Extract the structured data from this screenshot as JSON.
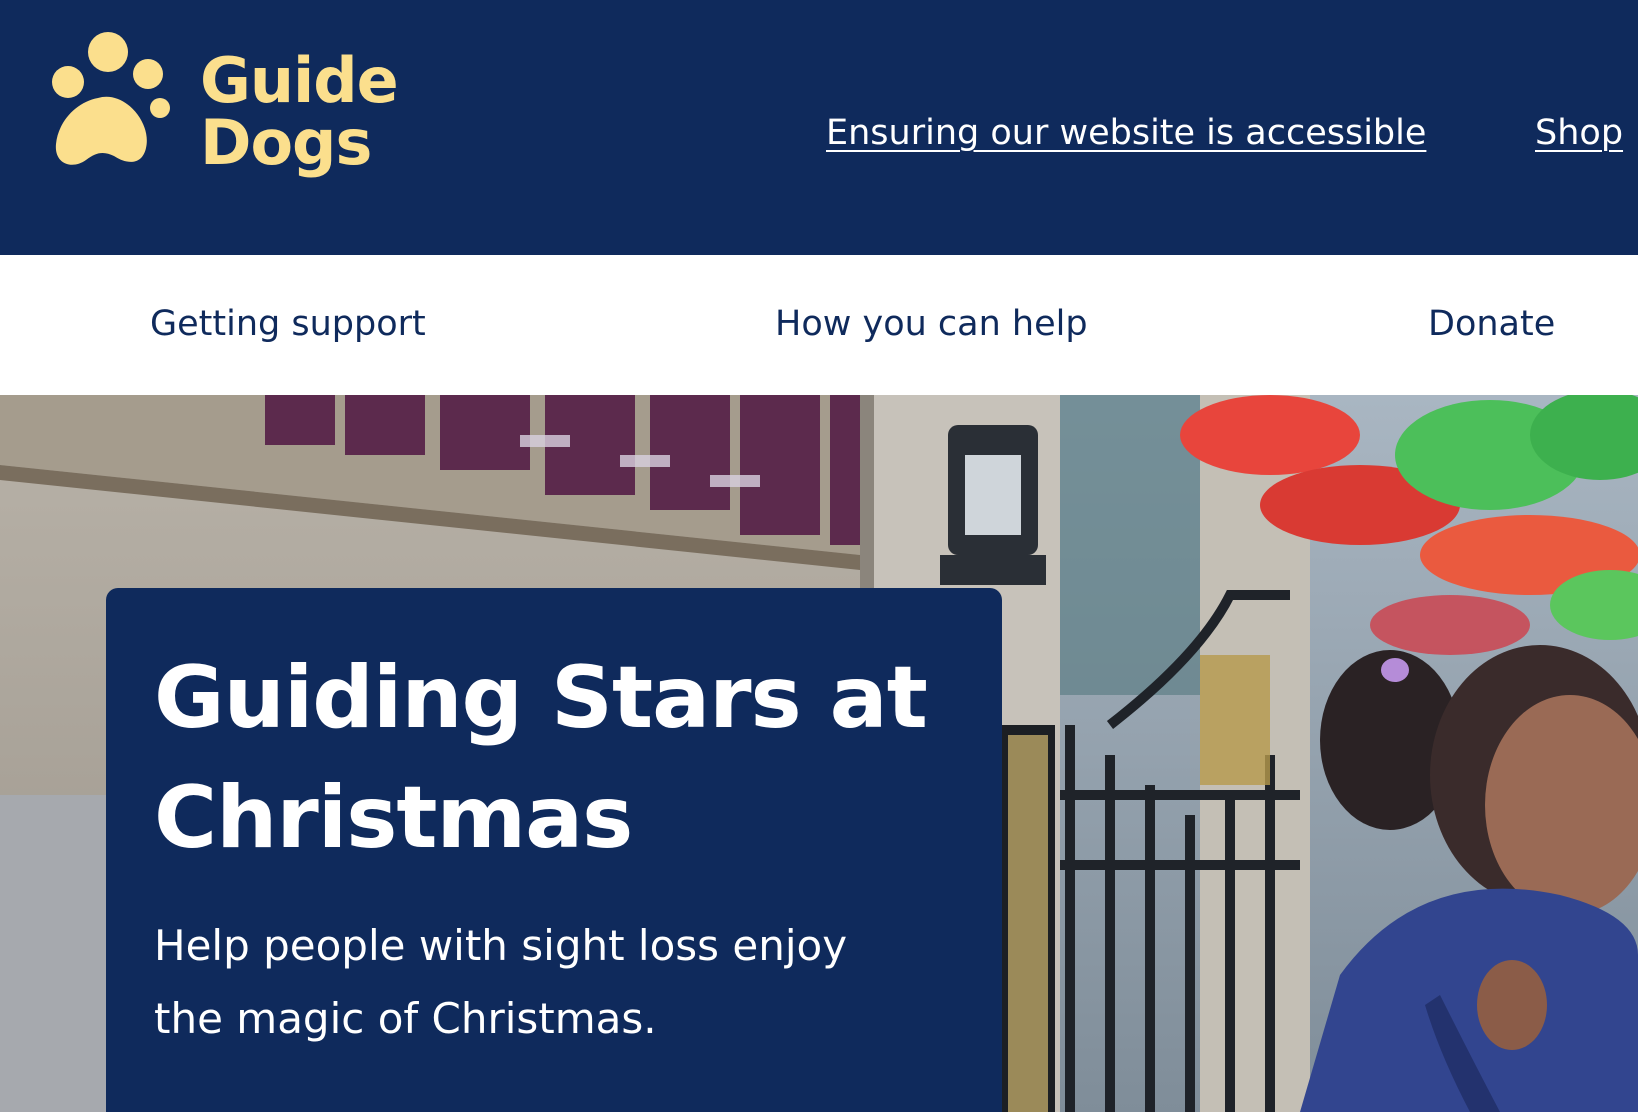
{
  "header": {
    "logo_line1": "Guide",
    "logo_line2": "Dogs",
    "utility_links": {
      "accessibility": "Ensuring our website is accessible",
      "shop": "Shop"
    }
  },
  "nav": {
    "items": [
      {
        "label": "Getting support"
      },
      {
        "label": "How you can help"
      },
      {
        "label": "Donate"
      }
    ]
  },
  "hero": {
    "title": "Guiding Stars at Christmas",
    "subtitle": "Help people with sight loss enjoy the magic of Christmas."
  },
  "colors": {
    "header_bg": "#0f2a5c",
    "logo_yellow": "#fbdf8d",
    "nav_bg": "#ffffff",
    "nav_text": "#0f2a5c",
    "hero_card_bg": "#0f2a5c"
  }
}
